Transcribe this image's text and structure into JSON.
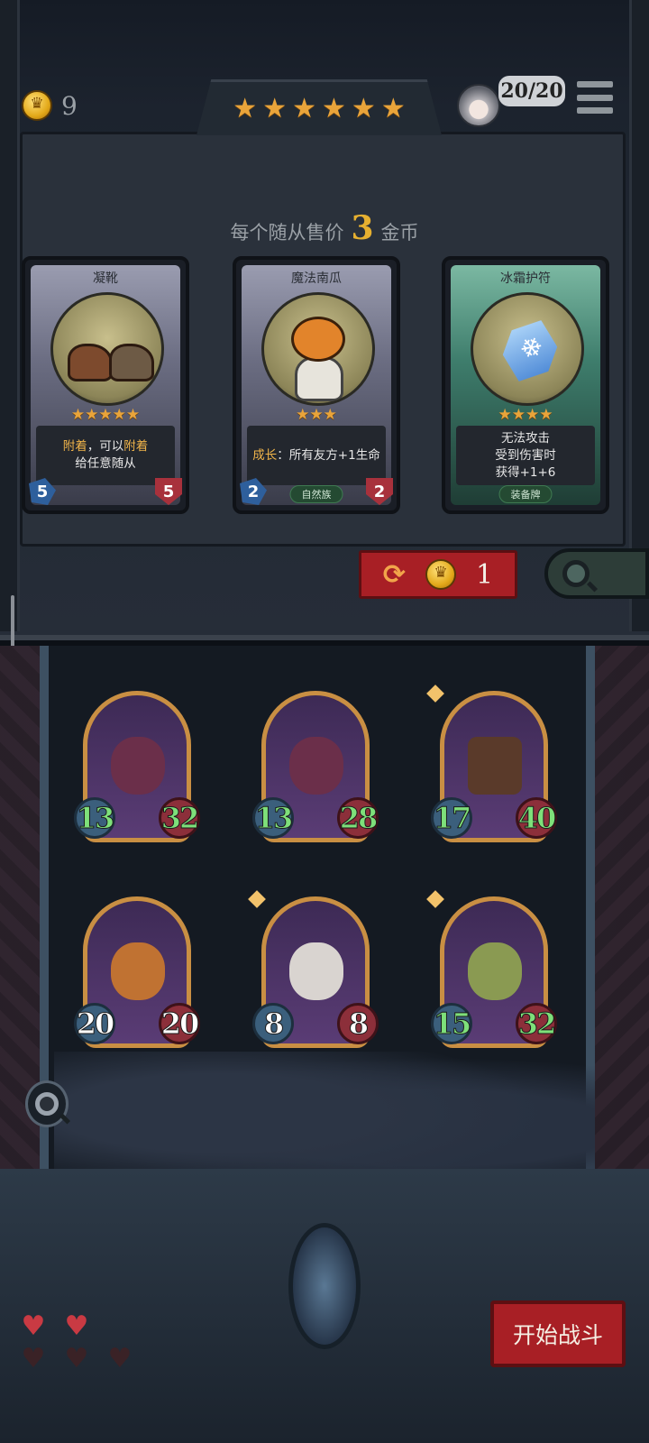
{
  "header": {
    "coins": "9",
    "stars": 6,
    "players": "20/20"
  },
  "shop": {
    "price_prefix": "每个随从售价",
    "price_value": "3",
    "price_suffix": "金币",
    "cards": [
      {
        "title": "凝靴",
        "stars": 5,
        "desc_parts": [
          "附着",
          "，可以",
          "附着"
        ],
        "desc_line2": "给任意随从",
        "attack": "5",
        "health": "5",
        "tribe": ""
      },
      {
        "title": "魔法南瓜",
        "stars": 3,
        "desc_keyword": "成长",
        "desc_rest": "：所有友方+1生命",
        "attack": "2",
        "health": "2",
        "tribe": "自然族"
      },
      {
        "title": "冰霜护符",
        "stars": 4,
        "desc_lines": [
          "无法攻击",
          "受到伤害时",
          "获得+1+6"
        ],
        "tribe": "装备牌"
      }
    ],
    "refresh_cost": "1"
  },
  "board": {
    "units": [
      {
        "attack": "13",
        "health": "32",
        "attack_color": "green",
        "health_color": "green",
        "name": "flower-witch"
      },
      {
        "attack": "13",
        "health": "28",
        "attack_color": "green",
        "health_color": "green",
        "name": "flower-witch"
      },
      {
        "attack": "17",
        "health": "40",
        "attack_color": "green",
        "health_color": "green",
        "name": "tree-golem"
      },
      {
        "attack": "20",
        "health": "20",
        "attack_color": "white",
        "health_color": "white",
        "name": "pumpkin-monster"
      },
      {
        "attack": "8",
        "health": "8",
        "attack_color": "white",
        "health_color": "white",
        "name": "jester"
      },
      {
        "attack": "15",
        "health": "32",
        "attack_color": "green",
        "health_color": "green",
        "name": "swamp-witch"
      }
    ]
  },
  "lives": {
    "full": 2,
    "total": 5
  },
  "start_button": "开始战斗",
  "colors": {
    "accent_red": "#a81f25",
    "gold": "#e6b030",
    "stat_green": "#7ee07a"
  }
}
